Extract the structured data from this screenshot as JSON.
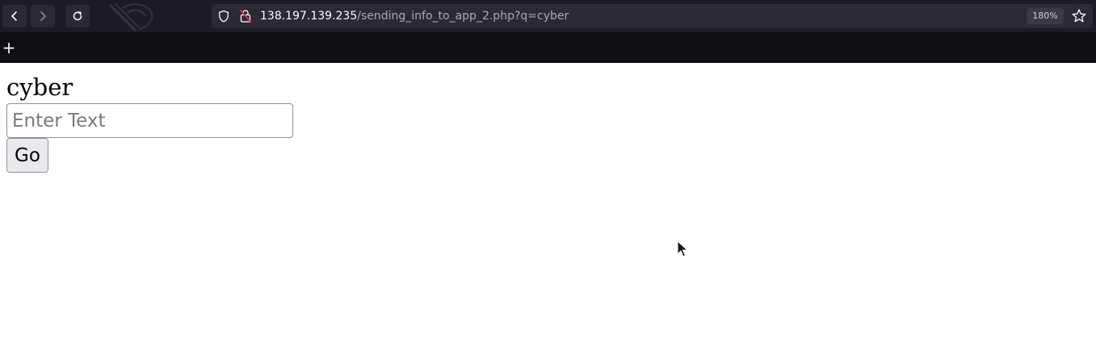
{
  "browser": {
    "url_host": "138.197.139.235",
    "url_path": "/sending_info_to_app_2.php?q=cyber",
    "zoom_level": "180%",
    "newtab_label": "+"
  },
  "icons": {
    "back": "back-arrow-icon",
    "forward": "forward-arrow-icon",
    "reload": "reload-icon",
    "shield": "shield-icon",
    "lock": "insecure-lock-icon",
    "bookmark": "star-icon",
    "cursor": "mouse-pointer-icon"
  },
  "page": {
    "heading": "cyber",
    "input_placeholder": "Enter Text",
    "input_value": "",
    "go_label": "Go"
  },
  "colors": {
    "toolbar_bg": "#1c1b22",
    "urlbar_bg": "#2b2a33",
    "tabstrip_bg": "#0f0e13",
    "button_bg": "#e9e9ed",
    "insecure_red": "#e22850"
  }
}
